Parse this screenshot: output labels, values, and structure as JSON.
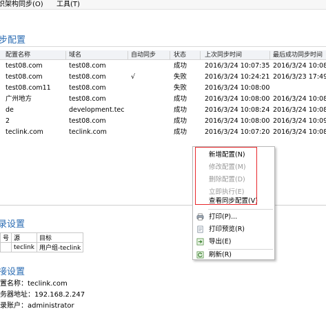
{
  "menubar": {
    "items": [
      "织架构同步(O)",
      "工具(T)"
    ]
  },
  "page_title": "步配置",
  "grid": {
    "columns": [
      "配置名称",
      "域名",
      "自动同步",
      "状态",
      "上次同步时间",
      "最后成功同步时间"
    ],
    "rows": [
      [
        "test08.com",
        "test08.com",
        "",
        "成功",
        "2016/3/24 10:07:35",
        "2016/3/24 10:08:0"
      ],
      [
        "test08.com",
        "test08.com",
        "√",
        "失败",
        "2016/3/24 10:24:21",
        "2016/3/23 17:49:1"
      ],
      [
        "test08.com11",
        "test08.com",
        "",
        "失败",
        "2016/3/24 10:08:00",
        ""
      ],
      [
        "广州地方",
        "test08.com",
        "",
        "成功",
        "2016/3/24 10:08:00",
        "2016/3/24 10:08:2"
      ],
      [
        "de",
        "development.tec",
        "",
        "成功",
        "2016/3/24 10:08:24",
        "2016/3/24 10:08:2"
      ],
      [
        "2",
        "test08.com",
        "",
        "成功",
        "2016/3/24 10:08:00",
        "2016/3/24 10:09:1"
      ],
      [
        "teclink.com",
        "teclink.com",
        "",
        "成功",
        "2016/3/24 10:07:20",
        "2016/3/24 10:08:0"
      ]
    ]
  },
  "context_menu": {
    "items": [
      {
        "label": "新增配置(N)",
        "disabled": false,
        "icon": ""
      },
      {
        "label": "修改配置(M)",
        "disabled": true,
        "icon": ""
      },
      {
        "label": "删除配置(D)",
        "disabled": true,
        "icon": ""
      },
      {
        "label": "立即执行(E)",
        "disabled": true,
        "icon": ""
      },
      {
        "label": "查看同步配置(V)",
        "disabled": false,
        "icon": ""
      },
      {
        "label": "打印(P)...",
        "disabled": false,
        "icon": "print-icon"
      },
      {
        "label": "打印预览(R)",
        "disabled": false,
        "icon": "print-preview-icon"
      },
      {
        "label": "导出(E)",
        "disabled": false,
        "icon": "export-icon"
      },
      {
        "label": "刷新(R)",
        "disabled": false,
        "icon": "refresh-icon"
      }
    ]
  },
  "source_section": {
    "title": "录设置",
    "headers": [
      "号",
      "源",
      "目标"
    ],
    "row": [
      "",
      "teclink",
      "用户组-teclink"
    ]
  },
  "sync_section": {
    "title": "接设置",
    "lines": [
      "置名称：teclink.com",
      "务器地址：192.168.2.247",
      "录账户：administrator"
    ]
  },
  "colors": {
    "section_title": "#2b6cb3",
    "highlight_box": "#e8262a"
  }
}
